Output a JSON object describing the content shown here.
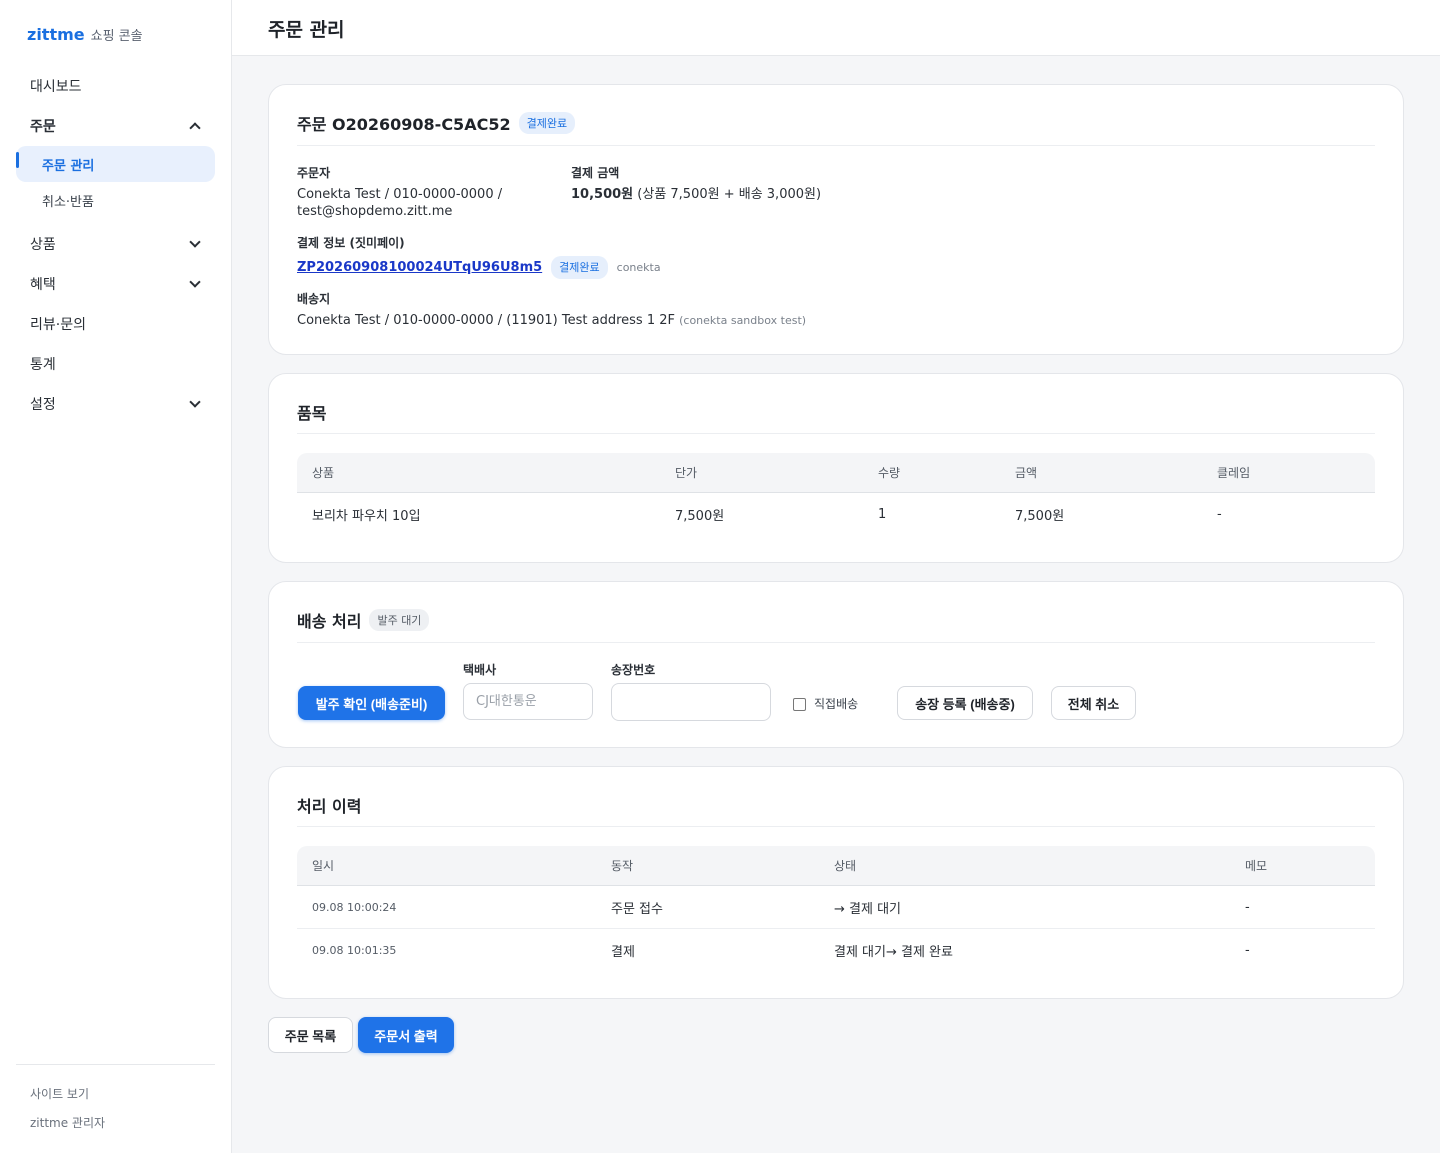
{
  "brand": {
    "name": "zittme",
    "sub": "쇼핑 콘솔"
  },
  "sidebar": {
    "items": [
      {
        "label": "대시보드"
      },
      {
        "label": "주문"
      },
      {
        "label": "상품"
      },
      {
        "label": "혜택"
      },
      {
        "label": "리뷰·문의"
      },
      {
        "label": "통계"
      },
      {
        "label": "설정"
      }
    ],
    "sub_items": [
      {
        "label": "주문 관리"
      },
      {
        "label": "취소·반품"
      }
    ],
    "footer": {
      "site": "사이트 보기",
      "admin": "zittme 관리자"
    }
  },
  "header": {
    "title": "주문 관리"
  },
  "order": {
    "title": "주문 O20260908-C5AC52",
    "status_badge": "결제완료",
    "orderer_label": "주문자",
    "orderer_line1": "Conekta Test / 010-0000-0000 /",
    "orderer_line2": "test@shopdemo.zitt.me",
    "amount_label": "결제 금액",
    "amount_total": "10,500원",
    "amount_detail": "(상품 7,500원 + 배송 3,000원)",
    "payment_label": "결제 정보 (짓미페이)",
    "payment_id": "ZP20260908100024UTqU96U8m5",
    "payment_badge": "결제완료",
    "payment_provider": "conekta",
    "shipping_label": "배송지",
    "shipping_address": "Conekta Test / 010-0000-0000 / (11901) Test address 1 2F",
    "shipping_note": "(conekta sandbox test)"
  },
  "items": {
    "title": "품목",
    "headers": [
      "상품",
      "단가",
      "수량",
      "금액",
      "클레임"
    ],
    "rows": [
      [
        "보리차 파우치 10입",
        "7,500원",
        "1",
        "7,500원",
        "-"
      ]
    ]
  },
  "shipping": {
    "title": "배송 처리",
    "badge": "발주 대기",
    "confirm_button": "발주 확인 (배송준비)",
    "courier_label": "택배사",
    "courier_placeholder": "CJ대한통운",
    "tracking_label": "송장번호",
    "tracking_value": "",
    "direct_label": "직접배송",
    "register_button": "송장 등록 (배송중)",
    "cancel_button": "전체 취소"
  },
  "history": {
    "title": "처리 이력",
    "headers": [
      "일시",
      "동작",
      "상태",
      "메모"
    ],
    "rows": [
      [
        "09.08 10:00:24",
        "주문 접수",
        "→ 결제 대기",
        "-"
      ],
      [
        "09.08 10:01:35",
        "결제",
        "결제 대기→ 결제 완료",
        "-"
      ]
    ]
  },
  "actions": {
    "list_button": "주문 목록",
    "print_button": "주문서 출력"
  }
}
